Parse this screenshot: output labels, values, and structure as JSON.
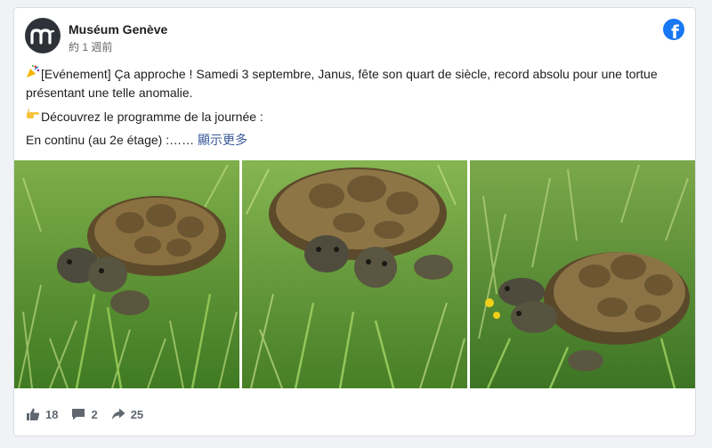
{
  "post": {
    "page_name": "Muséum Genève",
    "timestamp": "約 1 週前",
    "logo_text": "m",
    "network_logo": "f",
    "paragraph_1": "[Evénement] Ça approche ! Samedi 3 septembre, Janus, fête son quart de siècle, record absolu pour une tortue présentant une telle anomalie.",
    "paragraph_2": "Découvrez le programme de la journée :",
    "paragraph_3": "En continu (au 2e étage) :……",
    "see_more": "顯示更多",
    "icons": {
      "party": "party-popper-icon",
      "pointing": "pointing-hand-icon",
      "facebook": "facebook-logo-icon"
    },
    "photos": [
      {
        "name": "two-headed-tortoise-photo-1"
      },
      {
        "name": "two-headed-tortoise-photo-2"
      },
      {
        "name": "two-headed-tortoise-photo-3"
      }
    ],
    "counts": {
      "likes": "18",
      "comments": "2",
      "shares": "25"
    },
    "colors": {
      "brand": "#1877f2",
      "link": "#385898",
      "muted": "#65676b"
    }
  }
}
